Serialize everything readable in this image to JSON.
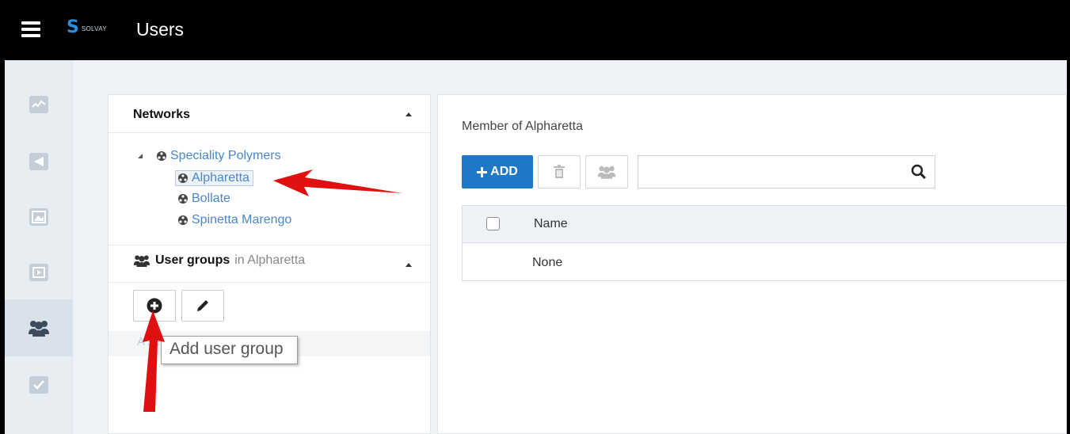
{
  "header": {
    "title": "Users",
    "logo_mark": "S",
    "logo_brand": "SOLVAY"
  },
  "rail": {
    "items": [
      {
        "icon": "activity-chart-icon"
      },
      {
        "icon": "slides-icon"
      },
      {
        "icon": "image-icon"
      },
      {
        "icon": "media-icon"
      },
      {
        "icon": "users-icon",
        "active": true
      },
      {
        "icon": "checkbox-icon"
      }
    ]
  },
  "networks": {
    "title": "Networks",
    "root": "Speciality Polymers",
    "children": [
      "Alpharetta",
      "Bollate",
      "Spinetta Marengo"
    ],
    "selected": "Alpharetta"
  },
  "user_groups": {
    "title": "User groups",
    "in_label": "in Alpharetta",
    "row_label": "A  sers",
    "tooltip": "Add user group"
  },
  "members": {
    "heading": "Member of Alpharetta",
    "add_label": "ADD",
    "search_placeholder": "",
    "column_name": "Name",
    "empty_value": "None"
  },
  "colors": {
    "accent": "#1e78c8",
    "link": "#4a86c8",
    "annotation": "#e01010"
  }
}
